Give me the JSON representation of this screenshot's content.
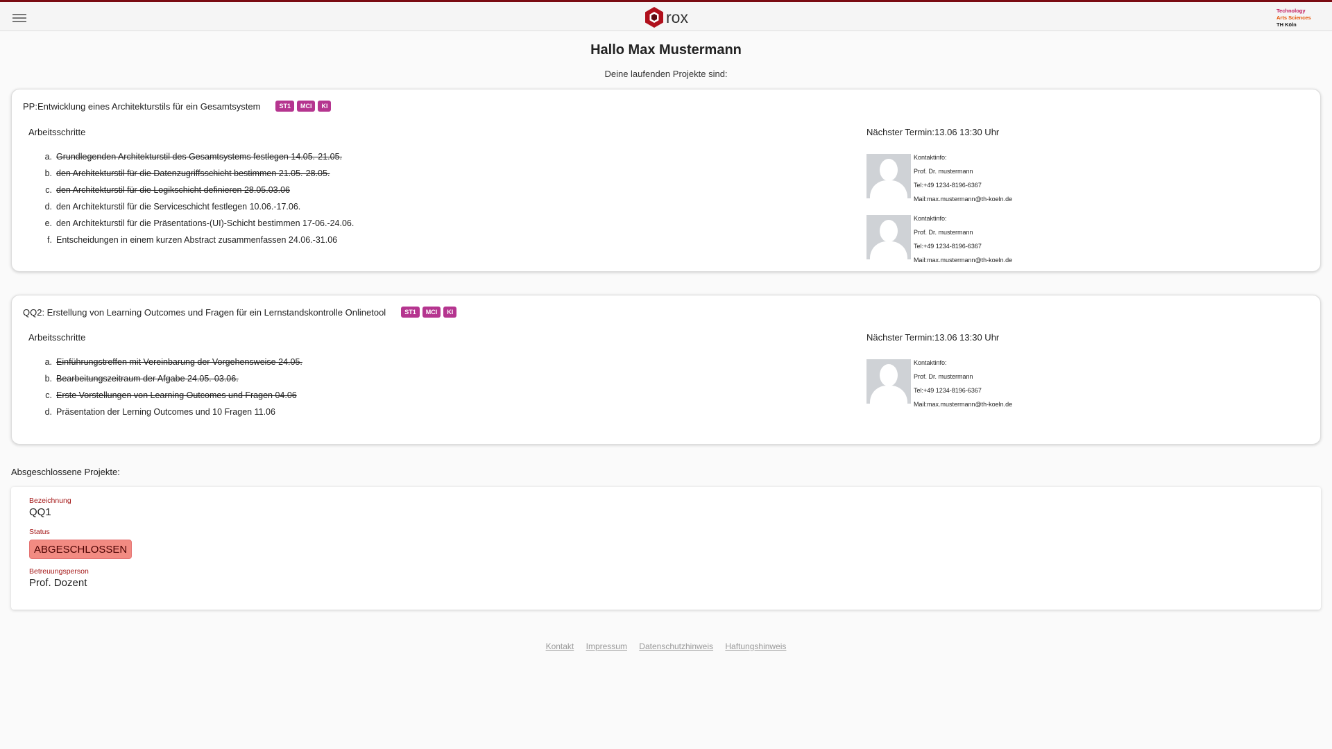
{
  "header": {
    "logo_text": "rox",
    "university": [
      "Technology",
      "Arts Sciences",
      "TH Köln"
    ],
    "brand_color": "#7a0b12"
  },
  "greeting": "Hallo Max Mustermann",
  "subgreeting": "Deine laufenden Projekte sind:",
  "projects": [
    {
      "title": "PP:Entwicklung eines Architekturstils für ein Gesamtsystem",
      "badges": [
        "ST1",
        "MCI",
        "KI"
      ],
      "steps_heading": "Arbeitsschritte",
      "steps": [
        {
          "marker": "a.",
          "text": "Grundlegenden Architekturstil des Gesamtsystems festlegen 14.05.-21.05.",
          "done": true
        },
        {
          "marker": "b.",
          "text": "den Architekturstil für die Datenzugriffsschicht bestimmen 21.05.-28.05.",
          "done": true
        },
        {
          "marker": "c.",
          "text": "den Architekturstil für die Logikschicht definieren 28.05.03.06",
          "done": true
        },
        {
          "marker": "d.",
          "text": "den Architekturstil für die Serviceschicht festlegen 10.06.-17.06.",
          "done": false
        },
        {
          "marker": "e.",
          "text": "den Architekturstil für die Präsentations-(UI)-Schicht bestimmen 17-06.-24.06.",
          "done": false
        },
        {
          "marker": "f.",
          "text": "Entscheidungen in einem kurzen Abstract zusammenfassen 24.06.-31.06",
          "done": false
        }
      ],
      "next_appointment": "Nächster Termin:13.06 13:30 Uhr",
      "contacts": [
        {
          "label": "Kontaktinfo:",
          "name": "Prof. Dr. mustermann",
          "tel": "Tel:+49 1234-8196-6367",
          "mail": "Mail:max.mustermann@th-koeln.de"
        },
        {
          "label": "Kontaktinfo:",
          "name": "Prof. Dr. mustermann",
          "tel": "Tel:+49 1234-8196-6367",
          "mail": "Mail:max.mustermann@th-koeln.de"
        }
      ]
    },
    {
      "title": "QQ2: Erstellung von Learning Outcomes und Fragen für ein Lernstandskontrolle Onlinetool",
      "badges": [
        "ST1",
        "MCI",
        "KI"
      ],
      "steps_heading": "Arbeitsschritte",
      "steps": [
        {
          "marker": "a.",
          "text": "Einführungstreffen mit Vereinbarung der Vorgehensweise 24.05.",
          "done": true
        },
        {
          "marker": "b.",
          "text": "Bearbeitungszeitraum der Afgabe 24.05.-03.06.",
          "done": true
        },
        {
          "marker": "c.",
          "text": "Erste Vorstellungen von Learning Outcomes und Fragen 04.06",
          "done": true
        },
        {
          "marker": "d.",
          "text": "Präsentation der Lerning Outcomes und 10 Fragen 11.06",
          "done": false
        }
      ],
      "next_appointment": "Nächster Termin:13.06 13:30 Uhr",
      "contacts": [
        {
          "label": "Kontaktinfo:",
          "name": "Prof. Dr. mustermann",
          "tel": "Tel:+49 1234-8196-6367",
          "mail": "Mail:max.mustermann@th-koeln.de"
        }
      ]
    }
  ],
  "completed": {
    "heading": "Absgeschlossene Projekte:",
    "designation_label": "Bezeichnung",
    "designation_value": "QQ1",
    "status_label": "Status",
    "status_value": "ABGESCHLOSSEN",
    "supervisor_label": "Betreuungsperson",
    "supervisor_value": "Prof. Dozent",
    "status_color": "#f28b82"
  },
  "footer": {
    "links": [
      "Kontakt",
      "Impressum",
      "Datenschutzhinweis",
      "Haftungshinweis"
    ]
  }
}
